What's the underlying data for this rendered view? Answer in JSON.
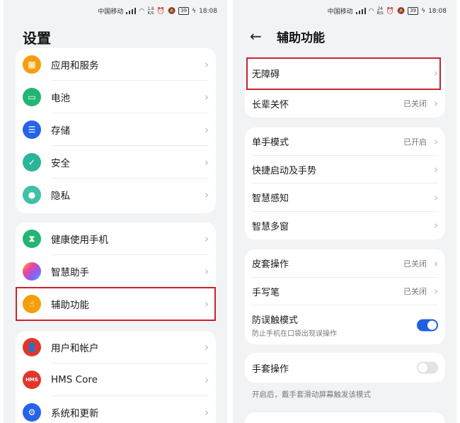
{
  "status_bar": {
    "carrier": "中国移动",
    "left_speed_value": "1.6",
    "right_speed_value": "24",
    "speed_unit_left": "K/s",
    "speed_unit_right": "B/s",
    "battery": "39",
    "time": "18:08"
  },
  "settings": {
    "title": "设置",
    "groups": [
      {
        "items": [
          {
            "label": "应用和服务",
            "icon": "apps-grid-icon",
            "color": "#f59e0b"
          },
          {
            "label": "电池",
            "icon": "battery-icon",
            "color": "#22b573"
          },
          {
            "label": "存储",
            "icon": "storage-icon",
            "color": "#2563eb"
          },
          {
            "label": "安全",
            "icon": "shield-icon",
            "color": "#2ab59a"
          },
          {
            "label": "隐私",
            "icon": "privacy-lock-icon",
            "color": "#3fc0a8"
          }
        ]
      },
      {
        "items": [
          {
            "label": "健康使用手机",
            "icon": "hourglass-icon",
            "color": "#22b573"
          },
          {
            "label": "智慧助手",
            "icon": "smart-assistant-icon",
            "color": "#c084fc"
          },
          {
            "label": "辅助功能",
            "icon": "hand-pointer-icon",
            "color": "#f59e0b"
          }
        ]
      },
      {
        "items": [
          {
            "label": "用户和帐户",
            "icon": "user-icon",
            "color": "#e0362c"
          },
          {
            "label": "HMS Core",
            "icon": "hms-icon",
            "color": "#e0362c",
            "icon_text": "HMS"
          },
          {
            "label": "系统和更新",
            "icon": "system-gear-icon",
            "color": "#2563eb"
          }
        ]
      }
    ]
  },
  "accessibility": {
    "back_icon": "back-arrow-icon",
    "title": "辅助功能",
    "groups": [
      {
        "items": [
          {
            "label": "无障碍",
            "value": ""
          },
          {
            "label": "长辈关怀",
            "value": "已关闭"
          }
        ]
      },
      {
        "items": [
          {
            "label": "单手模式",
            "value": "已开启"
          },
          {
            "label": "快捷启动及手势",
            "value": ""
          },
          {
            "label": "智慧感知",
            "value": ""
          },
          {
            "label": "智慧多窗",
            "value": ""
          }
        ]
      },
      {
        "items": [
          {
            "label": "皮套操作",
            "value": "已关闭"
          },
          {
            "label": "手写笔",
            "value": "已关闭"
          },
          {
            "label": "防误触模式",
            "sublabel": "防止手机在口袋出现误操作",
            "toggle": "on"
          }
        ]
      },
      {
        "items": [
          {
            "label": "手套操作",
            "toggle": "off"
          }
        ]
      }
    ],
    "glove_note": "开启后，戴手套滑动屏幕触发该模式"
  },
  "highlight_color": "#c8232f",
  "toggle_on_color": "#1f5fe0"
}
